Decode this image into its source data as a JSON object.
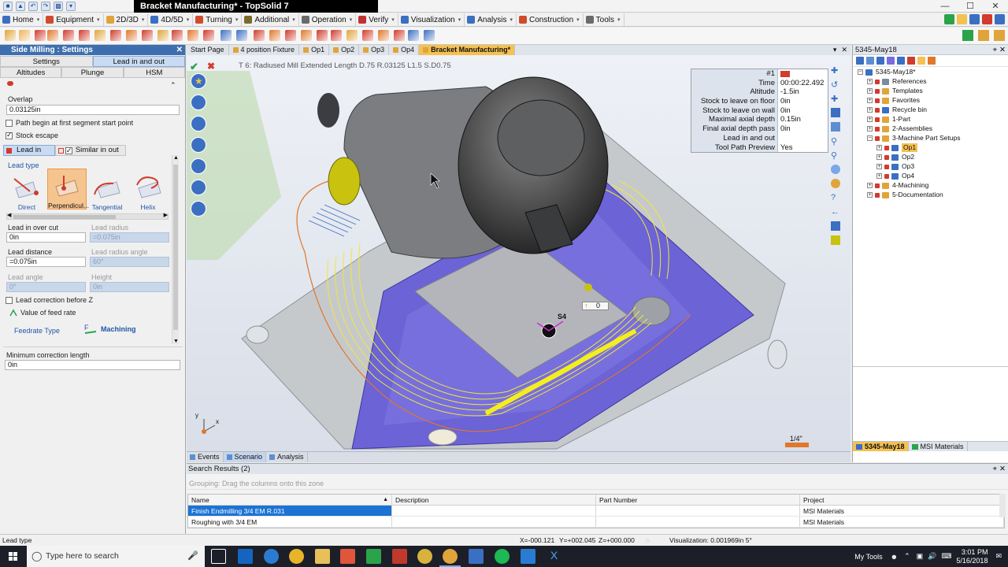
{
  "window": {
    "title": "Bracket Manufacturing* - TopSolid 7",
    "controls": [
      "—",
      "☐",
      "✕"
    ]
  },
  "menubar": {
    "items": [
      {
        "label": "Home",
        "icon": "home-icon",
        "color": "#3b6fc2"
      },
      {
        "label": "Equipment",
        "icon": "equipment-icon",
        "color": "#d14a2b"
      },
      {
        "label": "2D/3D",
        "icon": "2d3d-icon",
        "color": "#e0a43a"
      },
      {
        "label": "4D/5D",
        "icon": "4d5d-icon",
        "color": "#3b6fc2"
      },
      {
        "label": "Turning",
        "icon": "turning-icon",
        "color": "#d14a2b"
      },
      {
        "label": "Additional",
        "icon": "additional-icon",
        "color": "#7a6a2a"
      },
      {
        "label": "Operation",
        "icon": "operation-icon",
        "color": "#6a6a6a"
      },
      {
        "label": "Verify",
        "icon": "verify-icon",
        "color": "#c03030"
      },
      {
        "label": "Visualization",
        "icon": "visualization-icon",
        "color": "#3b6fc2"
      },
      {
        "label": "Analysis",
        "icon": "analysis-icon",
        "color": "#3b6fc2"
      },
      {
        "label": "Construction",
        "icon": "construction-icon",
        "color": "#d14a2b"
      },
      {
        "label": "Tools",
        "icon": "tools-icon",
        "color": "#6a6a6a"
      }
    ]
  },
  "left_panel": {
    "title": "Side Milling : Settings",
    "tabs_row1": [
      "Settings",
      "Lead in and out"
    ],
    "tabs_row2": [
      "Altitudes",
      "Plunge",
      "HSM"
    ],
    "overlap_label": "Overlap",
    "overlap_value": "0.03125in",
    "path_begin_label": "Path begin at first segment start point",
    "stock_escape_label": "Stock escape",
    "lead_tabs": [
      "Lead in",
      "Similar in out"
    ],
    "lead_type_label": "Lead type",
    "lead_types": [
      "Direct",
      "Perpendicul...",
      "Tangential",
      "Helix"
    ],
    "lead_in_over_cut_label": "Lead in over cut",
    "lead_in_over_cut_value": "0in",
    "lead_radius_label": "Lead radius",
    "lead_radius_value": "=0.075in",
    "lead_distance_label": "Lead distance",
    "lead_distance_value": "=0.075in",
    "lead_radius_angle_label": "Lead radius angle",
    "lead_radius_angle_value": "60°",
    "lead_angle_label": "Lead angle",
    "lead_angle_value": "0°",
    "height_label": "Height",
    "height_value": "0in",
    "lead_correction_label": "Lead correction before Z",
    "value_of_feed_rate_label": "Value of feed rate",
    "feedrate_type_label": "Feedrate Type",
    "feedrate_type_value": "Machining",
    "min_correction_label": "Minimum correction length",
    "min_correction_value": "0in"
  },
  "viewport": {
    "doc_tabs": [
      {
        "label": "Start Page"
      },
      {
        "label": "4 position Fixture"
      },
      {
        "label": "Op1"
      },
      {
        "label": "Op2"
      },
      {
        "label": "Op3"
      },
      {
        "label": "Op4"
      },
      {
        "label": "Bracket Manufacturing*"
      }
    ],
    "tool_caption": "T 6: Radiused Mill Extended Length D.75 R.03125 L1.5 S.D0.75",
    "info_table": {
      "header": "#1",
      "rows": [
        {
          "k": "Time",
          "v": "00:00:22.492"
        },
        {
          "k": "Altitude",
          "v": "-1.5in"
        },
        {
          "k": "Stock to leave on floor",
          "v": "0in"
        },
        {
          "k": "Stock to leave on wall",
          "v": "0in"
        },
        {
          "k": "Maximal axial depth",
          "v": "0.15in"
        },
        {
          "k": "Final axial depth pass",
          "v": "0in"
        },
        {
          "k": "Lead in and out",
          "v": ""
        },
        {
          "k": "Tool Path Preview",
          "v": "Yes"
        }
      ]
    },
    "point_label": "S4",
    "counter_value": "0",
    "scale_label": "1/4\"",
    "axis_x": "x",
    "axis_y": "y"
  },
  "bottom_tabs": [
    "Events",
    "Scenario",
    "Analysis"
  ],
  "right_panel": {
    "title": "5345-May18",
    "tree": [
      {
        "label": "5345-May18*",
        "level": 0,
        "color": "#3b6fc2"
      },
      {
        "label": "References",
        "level": 1,
        "color": "#7a8aa0"
      },
      {
        "label": "Templates",
        "level": 1,
        "color": "#e0a43a"
      },
      {
        "label": "Favorites",
        "level": 1,
        "color": "#e0a43a"
      },
      {
        "label": "Recycle bin",
        "level": 1,
        "color": "#3b6fc2"
      },
      {
        "label": "1-Part",
        "level": 1,
        "color": "#e0a43a"
      },
      {
        "label": "2-Assemblies",
        "level": 1,
        "color": "#e0a43a"
      },
      {
        "label": "3-Machine Part Setups",
        "level": 1,
        "color": "#e0a43a"
      },
      {
        "label": "Op1",
        "level": 2,
        "color": "#3b6fc2"
      },
      {
        "label": "Op2",
        "level": 2,
        "color": "#3b6fc2"
      },
      {
        "label": "Op3",
        "level": 2,
        "color": "#3b6fc2"
      },
      {
        "label": "Op4",
        "level": 2,
        "color": "#3b6fc2"
      },
      {
        "label": "4-Machining",
        "level": 1,
        "color": "#e0a43a"
      },
      {
        "label": "5-Documentation",
        "level": 1,
        "color": "#e0a43a"
      }
    ],
    "tabs": [
      "5345-May18",
      "MSI Materials"
    ]
  },
  "search": {
    "title": "Search Results (2)",
    "group_hint": "Grouping: Drag the columns onto this zone",
    "columns": [
      "Name",
      "Description",
      "Part Number",
      "Project"
    ],
    "rows": [
      {
        "name": "Finish Endmilling 3/4 EM R.031",
        "description": "",
        "part": "",
        "project": "MSI Materials"
      },
      {
        "name": "Roughing with 3/4 EM",
        "description": "",
        "part": "",
        "project": "MSI Materials"
      }
    ]
  },
  "status": {
    "left": "Lead type",
    "x": "X=-000.121",
    "y": "Y=+002.045",
    "z": "Z=+000.000",
    "visualization": "Visualization: 0.001969in 5°"
  },
  "taskbar": {
    "search_placeholder": "Type here to search",
    "my_tools": "My Tools",
    "time": "3:01 PM",
    "date": "5/16/2018"
  }
}
